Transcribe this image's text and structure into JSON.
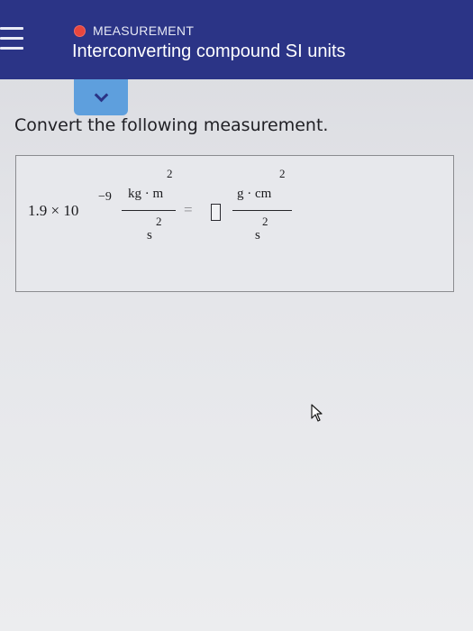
{
  "header": {
    "topic": "MEASUREMENT",
    "title": "Interconverting compound SI units",
    "accent_color": "#2b3486",
    "topic_dot_color": "#e8463e"
  },
  "toggle": {
    "icon": "chevron-down-icon",
    "color": "#5e9fdd"
  },
  "prompt": "Convert the following measurement.",
  "problem": {
    "coefficient": "1.9 × 10",
    "exponent": "−9",
    "left_numerator": "kg · m",
    "left_numerator_power": "2",
    "left_denominator": "s",
    "left_denominator_power": "2",
    "equals": "=",
    "right_numerator": "g · cm",
    "right_numerator_power": "2",
    "right_denominator": "s",
    "right_denominator_power": "2"
  }
}
